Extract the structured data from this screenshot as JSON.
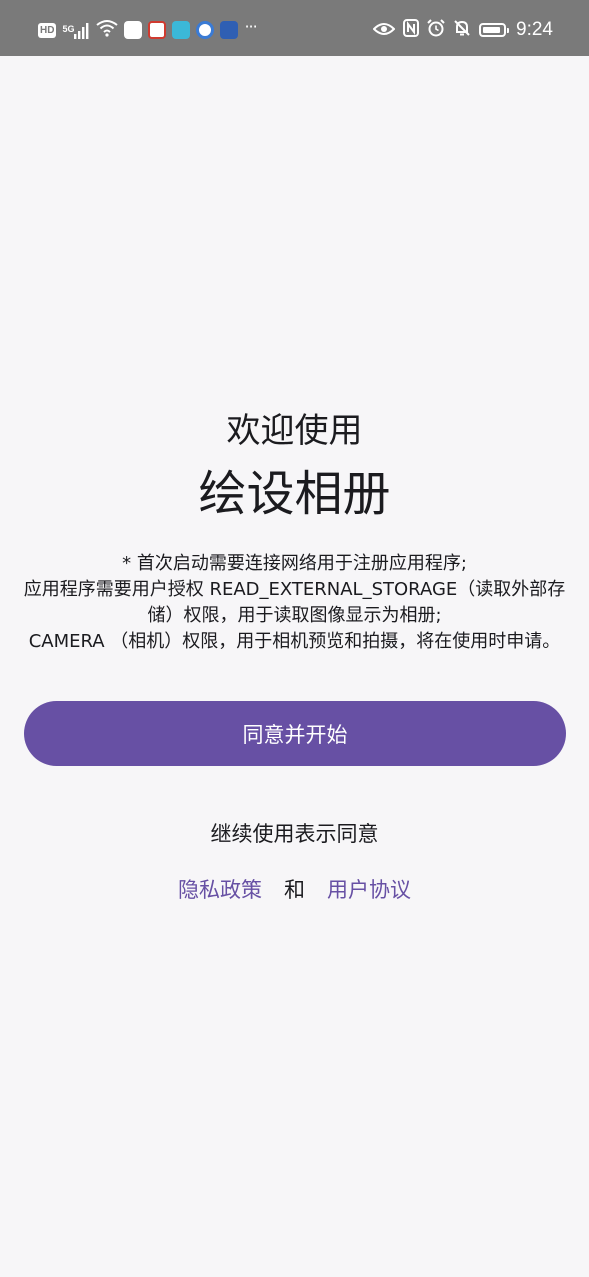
{
  "status_bar": {
    "hd_label": "HD",
    "network_label": "5G",
    "overflow_dots": "···",
    "time": "9:24"
  },
  "welcome": {
    "greeting": "欢迎使用",
    "app_name": "绘设相册"
  },
  "notice": {
    "line1": "* 首次启动需要连接网络用于注册应用程序;",
    "line2": "应用程序需要用户授权 READ_EXTERNAL_STORAGE（读取外部存储）权限，用于读取图像显示为相册;",
    "line3": "CAMERA （相机）权限，用于相机预览和拍摄，将在使用时申请。"
  },
  "actions": {
    "start_button_label": "同意并开始"
  },
  "agreement": {
    "continue_text": "继续使用表示同意",
    "privacy_policy_label": "隐私政策",
    "and_text": "和",
    "user_agreement_label": "用户协议"
  },
  "colors": {
    "accent": "#6750a4",
    "background": "#f7f6f8",
    "status_bar": "#7a7a7a",
    "text": "#1b1b1f"
  }
}
